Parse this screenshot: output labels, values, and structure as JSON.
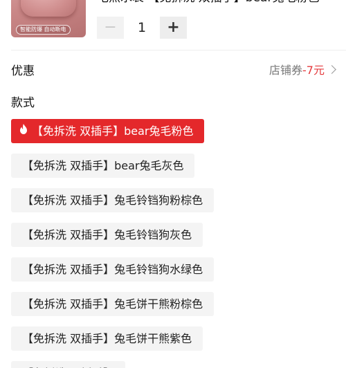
{
  "product": {
    "image_caption": "智能防爆 自动断电",
    "title": "电热水袋 【免拆洗 双插手】bear兔毛粉色",
    "quantity": "1",
    "minus_symbol": "−",
    "plus_symbol": "+"
  },
  "promo": {
    "label": "优惠",
    "coupon_text": "店铺券",
    "coupon_value": "-7元"
  },
  "styles": {
    "label": "款式",
    "options": [
      "【免拆洗 双插手】bear兔毛粉色",
      "【免拆洗 双插手】bear兔毛灰色",
      "【免拆洗 双插手】兔毛铃铛狗粉棕色",
      "【免拆洗 双插手】兔毛铃铛狗灰色",
      "【免拆洗 双插手】兔毛铃铛狗水绿色",
      "【免拆洗 双插手】兔毛饼干熊粉棕色",
      "【免拆洗 双插手】兔毛饼干熊紫色",
      "【免拆洗 双插手】"
    ],
    "selected_index": 0
  },
  "colors": {
    "accent_red": "#e4282b",
    "price_red": "#e4393c",
    "option_bg": "#f4f4f4"
  },
  "icons": {
    "selected_marker": "flame-icon",
    "coupon_arrow": "chevron-right-icon"
  }
}
